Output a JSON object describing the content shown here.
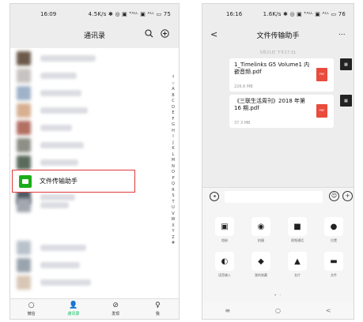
{
  "contacts_screen": {
    "status": {
      "time": "16:09",
      "network": "4.5K/s ✱ ◎ ▣ ᵀᴬᴸᴸ ▣ ᴬᴸᴸ ▭ 75"
    },
    "nav": {
      "title": "通讯录",
      "search_icon": "search-icon",
      "add_icon": "add-icon"
    },
    "index_letters": [
      "↑",
      "☆",
      "A",
      "B",
      "C",
      "D",
      "E",
      "F",
      "G",
      "H",
      "I",
      "J",
      "K",
      "L",
      "M",
      "N",
      "O",
      "P",
      "Q",
      "R",
      "S",
      "T",
      "U",
      "V",
      "W",
      "X",
      "Y",
      "Z",
      "#"
    ],
    "file_transfer": {
      "label": "文件传输助手",
      "highlight_color": "#e03a3a"
    },
    "tabs": [
      {
        "label": "微信",
        "icon": "○"
      },
      {
        "label": "通讯录",
        "icon": "👤"
      },
      {
        "label": "发现",
        "icon": "⊘"
      },
      {
        "label": "我",
        "icon": "♀"
      }
    ]
  },
  "chat_screen": {
    "status": {
      "time": "16:16",
      "network": "1.6K/s ✱ ◎ ▣ ᵀᴬᴸᴸ ▣ ᴬᴸᴸ ▭ 76"
    },
    "nav": {
      "title": "文件传输助手",
      "back_icon": "<",
      "more_icon": "..."
    },
    "date": "5月21日 下午17:31",
    "messages": [
      {
        "file_name": "1_Timelinks G5 Volume1 内嵌音频.pdf",
        "file_size": "226.6 MB",
        "file_type": "PDF"
      },
      {
        "file_name": "《三联生活周刊》2018 年第 16 期.pdf",
        "file_size": "37.3 MB",
        "file_type": "PDF"
      }
    ],
    "input_bar": {
      "voice_icon": "voice-icon",
      "emoji_icon": "emoji-icon",
      "plus_icon": "plus-icon"
    },
    "panel": [
      {
        "label": "相册",
        "icon": "▣"
      },
      {
        "label": "拍摄",
        "icon": "◉"
      },
      {
        "label": "视频通话",
        "icon": "■"
      },
      {
        "label": "位置",
        "icon": "●"
      },
      {
        "label": "语音输入",
        "icon": "◐"
      },
      {
        "label": "我的收藏",
        "icon": "◆"
      },
      {
        "label": "名片",
        "icon": "▲"
      },
      {
        "label": "文件",
        "icon": "▬"
      }
    ],
    "page_indicator": "• ·",
    "system_nav": [
      "≡",
      "○",
      "<"
    ]
  }
}
